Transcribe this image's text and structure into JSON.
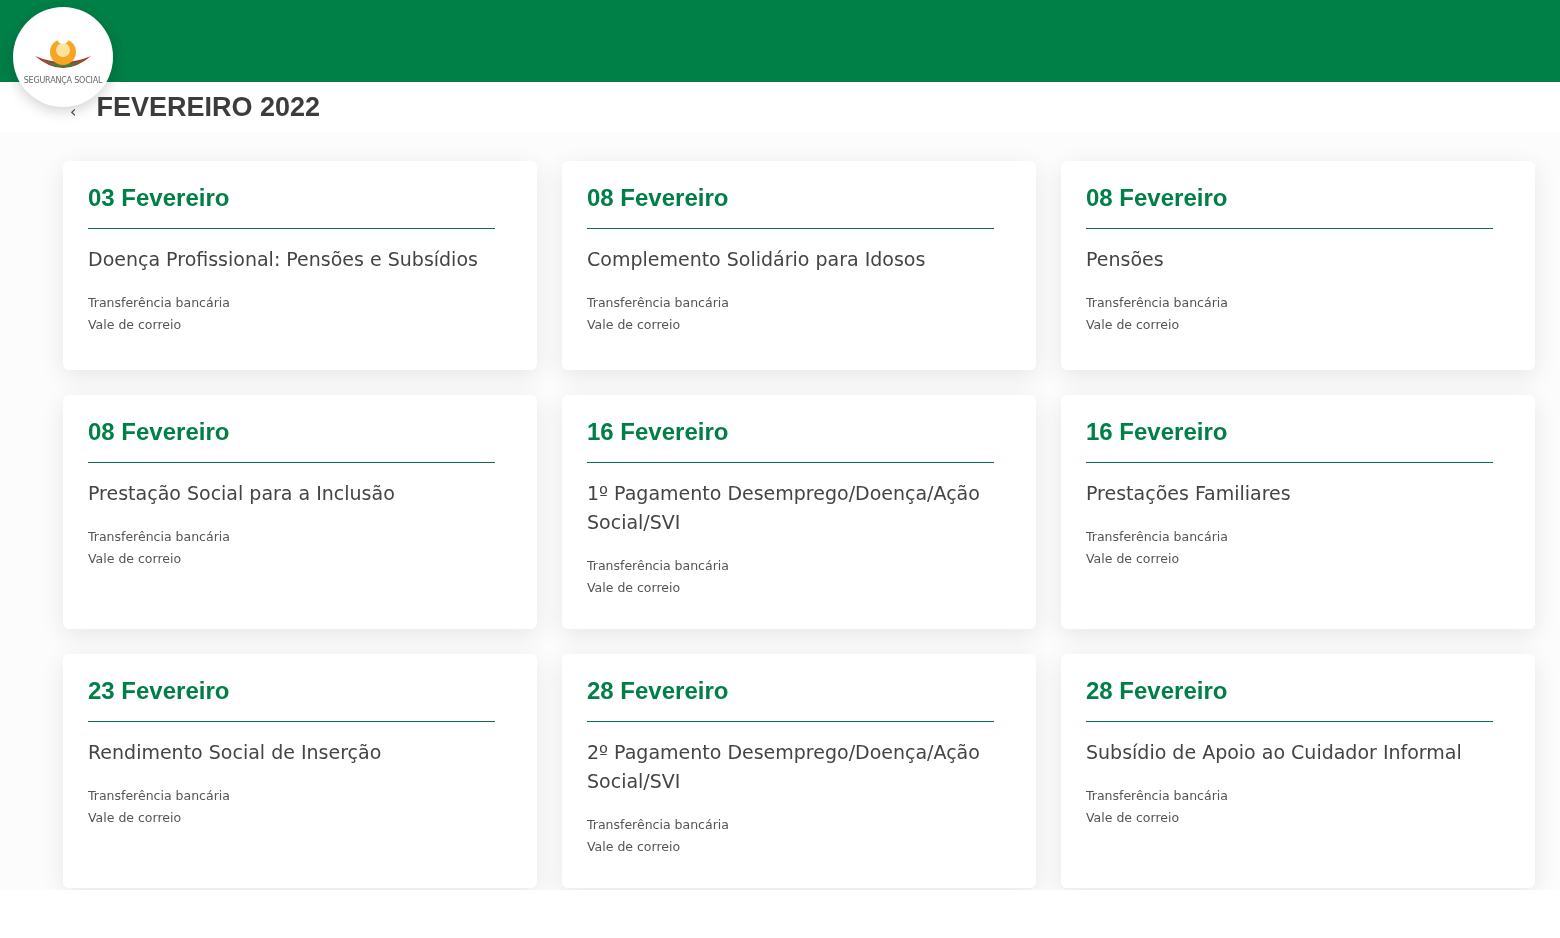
{
  "logo": {
    "text": "SEGURANÇA SOCIAL"
  },
  "heading": {
    "back": "‹",
    "title": "FEVEREIRO 2022"
  },
  "cards": [
    {
      "date": "03 Fevereiro",
      "benefit": "Doença Profissional: Pensões e Subsídios",
      "methods": [
        "Transferência bancária",
        "Vale de correio"
      ]
    },
    {
      "date": "08 Fevereiro",
      "benefit": "Complemento Solidário para Idosos",
      "methods": [
        "Transferência bancária",
        "Vale de correio"
      ]
    },
    {
      "date": "08 Fevereiro",
      "benefit": "Pensões",
      "methods": [
        "Transferência bancária",
        "Vale de correio"
      ]
    },
    {
      "date": "08 Fevereiro",
      "benefit": "Prestação Social para a Inclusão",
      "methods": [
        "Transferência bancária",
        "Vale de correio"
      ]
    },
    {
      "date": "16 Fevereiro",
      "benefit": "1º Pagamento Desemprego/Doença/Ação Social/SVI",
      "methods": [
        "Transferência bancária",
        "Vale de correio"
      ]
    },
    {
      "date": "16 Fevereiro",
      "benefit": "Prestações Familiares",
      "methods": [
        "Transferência bancária",
        "Vale de correio"
      ]
    },
    {
      "date": "23 Fevereiro",
      "benefit": "Rendimento Social de Inserção",
      "methods": [
        "Transferência bancária",
        "Vale de correio"
      ]
    },
    {
      "date": "28 Fevereiro",
      "benefit": "2º Pagamento Desemprego/Doença/Ação Social/SVI",
      "methods": [
        "Transferência bancária",
        "Vale de correio"
      ]
    },
    {
      "date": "28 Fevereiro",
      "benefit": "Subsídio de Apoio ao Cuidador Informal",
      "methods": [
        "Transferência bancária",
        "Vale de correio"
      ]
    }
  ]
}
